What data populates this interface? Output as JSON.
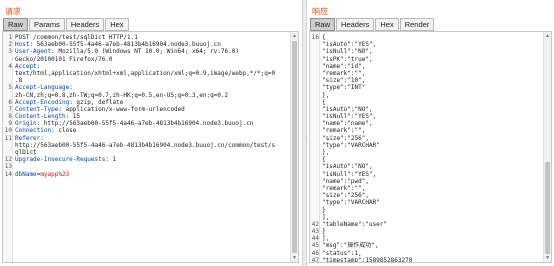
{
  "request": {
    "title": "请求",
    "tabs": [
      "Raw",
      "Params",
      "Headers",
      "Hex"
    ],
    "active_tab": "Raw",
    "lines": [
      {
        "n": "1",
        "parts": [
          {
            "t": "POST /common/test/sqlDict HTTP/1.1",
            "c": ""
          }
        ]
      },
      {
        "n": "2",
        "parts": [
          {
            "t": "Host",
            "c": "hn"
          },
          {
            "t": ": 563aeb00-55f5-4a46-a7eb-4813b4b16904.node3.buuoj.cn",
            "c": ""
          }
        ]
      },
      {
        "n": "3",
        "parts": [
          {
            "t": "User-Agent",
            "c": "hn"
          },
          {
            "t": ": Mozilla/5.0 (Windows NT 10.0; Win64; x64; rv:76.0)",
            "c": ""
          }
        ]
      },
      {
        "n": "",
        "parts": [
          {
            "t": "Gecko/20100101 Firefox/76.0",
            "c": ""
          }
        ]
      },
      {
        "n": "4",
        "parts": [
          {
            "t": "Accept",
            "c": "hn"
          },
          {
            "t": ":",
            "c": ""
          }
        ]
      },
      {
        "n": "",
        "parts": [
          {
            "t": "text/html,application/xhtml+xml,application/xml;q=0.9,image/webp,*/*;q=0",
            "c": ""
          }
        ]
      },
      {
        "n": "",
        "parts": [
          {
            "t": ".8",
            "c": ""
          }
        ]
      },
      {
        "n": "5",
        "parts": [
          {
            "t": "Accept-Language",
            "c": "hn"
          },
          {
            "t": ":",
            "c": ""
          }
        ]
      },
      {
        "n": "",
        "parts": [
          {
            "t": "zh-CN,zh;q=0.8,zh-TW;q=0.7,zh-HK;q=0.5,en-US;q=0.3,en;q=0.2",
            "c": ""
          }
        ]
      },
      {
        "n": "6",
        "parts": [
          {
            "t": "Accept-Encoding",
            "c": "hn"
          },
          {
            "t": ": gzip, deflate",
            "c": ""
          }
        ]
      },
      {
        "n": "7",
        "parts": [
          {
            "t": "Content-Type",
            "c": "hn"
          },
          {
            "t": ": application/x-www-form-urlencoded",
            "c": ""
          }
        ]
      },
      {
        "n": "8",
        "parts": [
          {
            "t": "Content-Length",
            "c": "hn"
          },
          {
            "t": ": 15",
            "c": ""
          }
        ]
      },
      {
        "n": "9",
        "parts": [
          {
            "t": "Origin",
            "c": "hn"
          },
          {
            "t": ": http://563aeb00-55f5-4a46-a7eb-4813b4b16904.node3.buuoj.cn",
            "c": ""
          }
        ]
      },
      {
        "n": "10",
        "parts": [
          {
            "t": "Connection",
            "c": "hn"
          },
          {
            "t": ": close",
            "c": ""
          }
        ]
      },
      {
        "n": "11",
        "parts": [
          {
            "t": "Referer",
            "c": "hn"
          },
          {
            "t": ":",
            "c": ""
          }
        ]
      },
      {
        "n": "",
        "parts": [
          {
            "t": "http://563aeb00-55f5-4a46-a7eb-4813b4b16904.node3.buuoj.cn/common/test/s",
            "c": ""
          }
        ]
      },
      {
        "n": "",
        "parts": [
          {
            "t": "qlDict",
            "c": ""
          }
        ]
      },
      {
        "n": "12",
        "parts": [
          {
            "t": "Upgrade-Insecure-Requests",
            "c": "hn"
          },
          {
            "t": ": 1",
            "c": ""
          }
        ]
      },
      {
        "n": "13",
        "parts": [
          {
            "t": "",
            "c": ""
          }
        ]
      },
      {
        "n": "14",
        "parts": [
          {
            "t": "dbName",
            "c": "hn"
          },
          {
            "t": "=",
            "c": ""
          },
          {
            "t": "myapp%23",
            "c": "pv"
          }
        ]
      }
    ]
  },
  "response": {
    "title": "响应",
    "tabs": [
      "Raw",
      "Headers",
      "Hex",
      "Render"
    ],
    "active_tab": "Raw",
    "lines": [
      {
        "n": "16",
        "t": "{"
      },
      {
        "n": "",
        "t": "\"isAuto\":\"YES\","
      },
      {
        "n": "",
        "t": "\"isNull\":\"NO\","
      },
      {
        "n": "",
        "t": "\"isPK\":\"true\","
      },
      {
        "n": "",
        "t": "\"name\":\"id\","
      },
      {
        "n": "",
        "t": "\"remark\":\"\","
      },
      {
        "n": "",
        "t": "\"size\":\"10\","
      },
      {
        "n": "",
        "t": "\"type\":\"INT\""
      },
      {
        "n": "",
        "t": "},"
      },
      {
        "n": "",
        "t": "{"
      },
      {
        "n": "",
        "t": "\"isAuto\":\"NO\","
      },
      {
        "n": "",
        "t": "\"isNull\":\"YES\","
      },
      {
        "n": "",
        "t": "\"name\":\"name\","
      },
      {
        "n": "",
        "t": "\"remark\":\"\","
      },
      {
        "n": "",
        "t": "\"size\":\"256\","
      },
      {
        "n": "",
        "t": "\"type\":\"VARCHAR\""
      },
      {
        "n": "",
        "t": "},"
      },
      {
        "n": "",
        "t": "{"
      },
      {
        "n": "",
        "t": "\"isAuto\":\"NO\","
      },
      {
        "n": "",
        "t": "\"isNull\":\"YES\","
      },
      {
        "n": "",
        "t": "\"name\":\"pwd\","
      },
      {
        "n": "",
        "t": "\"remark\":\"\","
      },
      {
        "n": "",
        "t": "\"size\":\"256\","
      },
      {
        "n": "",
        "t": "\"type\":\"VARCHAR\""
      },
      {
        "n": "",
        "t": "}"
      },
      {
        "n": "",
        "t": "],"
      },
      {
        "n": "42",
        "t": "\"tableName\":\"user\""
      },
      {
        "n": "43",
        "t": "}"
      },
      {
        "n": "44",
        "t": "],"
      },
      {
        "n": "45",
        "t": "\"msg\":\"操作成功\","
      },
      {
        "n": "46",
        "t": "\"status\":1,"
      },
      {
        "n": "47",
        "t": "\"timestamp\":1589852863270"
      },
      {
        "n": "48",
        "t": "}"
      }
    ]
  }
}
